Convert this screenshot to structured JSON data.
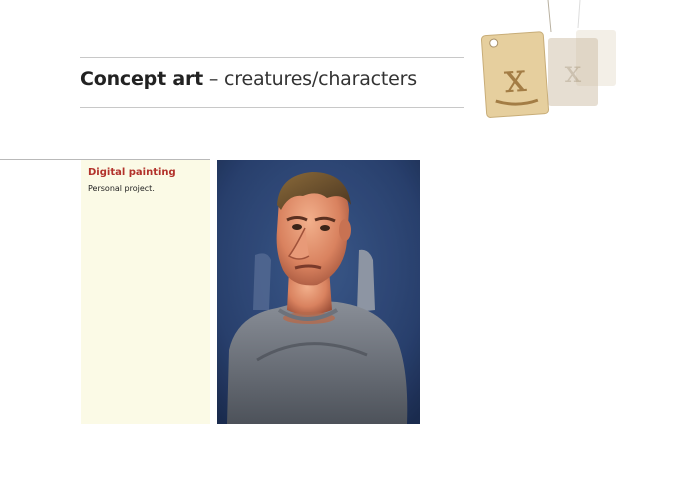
{
  "header": {
    "title_bold": "Concept art",
    "title_rest": "– creatures/characters"
  },
  "section": {
    "heading": "Digital painting",
    "description": "Personal project."
  },
  "artwork": {
    "subject": "painted portrait of a man in a grey shirt"
  },
  "logo": {
    "icon": "hanging-tag-logo-icon"
  },
  "colors": {
    "heading": "#b2322b",
    "panel_background": "#fbfae6",
    "rule": "#c8c8c8"
  }
}
